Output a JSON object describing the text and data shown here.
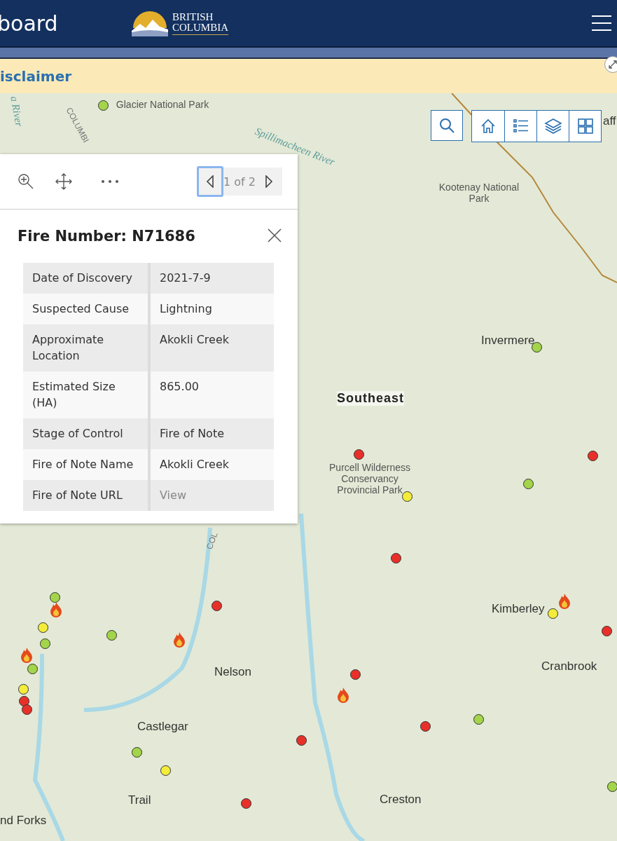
{
  "header": {
    "title": "board",
    "logo_line_1": "BRITISH",
    "logo_line_2": "COLUMBIA"
  },
  "disclaimer": {
    "label": "isclaimer"
  },
  "map": {
    "labels": [
      {
        "text": "Glacier National Park",
        "kind": "park"
      },
      {
        "text": "a River",
        "kind": "water"
      },
      {
        "text": "COLUMBI",
        "kind": "road"
      },
      {
        "text": "Spillimacheen River",
        "kind": "water"
      },
      {
        "text": "aff",
        "kind": "place"
      },
      {
        "text": "Kootenay National Park",
        "kind": "park"
      },
      {
        "text": "Invermere",
        "kind": "place"
      },
      {
        "text": "Southeast",
        "kind": "region"
      },
      {
        "text": "Purcell Wilderness Conservancy Provincial Park",
        "kind": "park"
      },
      {
        "text": "COL",
        "kind": "road"
      },
      {
        "text": "Kimberley",
        "kind": "place"
      },
      {
        "text": "Cranbrook",
        "kind": "place"
      },
      {
        "text": "Nelson",
        "kind": "place"
      },
      {
        "text": "Castlegar",
        "kind": "place"
      },
      {
        "text": "Trail",
        "kind": "place"
      },
      {
        "text": "Creston",
        "kind": "place"
      },
      {
        "text": "nd Forks",
        "kind": "place"
      }
    ],
    "markers": [
      {
        "color": "#a3d44a"
      },
      {
        "color": "#a3d44a"
      },
      {
        "color": "#e8302a"
      },
      {
        "color": "#e8302a"
      },
      {
        "color": "#a3d44a"
      },
      {
        "color": "#f3ec3b"
      },
      {
        "color": "#e8302a"
      },
      {
        "color": "#a3d44a"
      },
      {
        "color": "#e8302a"
      },
      {
        "color": "#f3ec3b"
      },
      {
        "color": "#f3ec3b"
      },
      {
        "color": "#a3d44a"
      },
      {
        "color": "#e8302a"
      },
      {
        "color": "#a3d44a"
      },
      {
        "color": "#a3d44a"
      },
      {
        "color": "#e8302a"
      },
      {
        "color": "#f3ec3b"
      },
      {
        "color": "#e8302a"
      },
      {
        "color": "#e8302a"
      },
      {
        "color": "#a3d44a"
      },
      {
        "color": "#e8302a"
      },
      {
        "color": "#e8302a"
      },
      {
        "color": "#a3d44a"
      },
      {
        "color": "#f3ec3b"
      },
      {
        "color": "#e8302a"
      },
      {
        "color": "#a3d44a"
      }
    ]
  },
  "popup": {
    "prev_focused": true,
    "pager": "1 of 2",
    "title": "Fire Number: N71686",
    "rows": [
      {
        "field": "Date of Discovery",
        "value": "2021-7-9",
        "kind": "text"
      },
      {
        "field": "Suspected Cause",
        "value": "Lightning",
        "kind": "text"
      },
      {
        "field": "Approximate Location",
        "value": "Akokli Creek",
        "kind": "text"
      },
      {
        "field": "Estimated Size (HA)",
        "value": "865.00",
        "kind": "text"
      },
      {
        "field": "Stage of Control",
        "value": "Fire of Note",
        "kind": "text"
      },
      {
        "field": "Fire of Note Name",
        "value": "Akokli Creek",
        "kind": "text"
      },
      {
        "field": "Fire of Note URL",
        "value": "View",
        "kind": "link"
      }
    ]
  }
}
